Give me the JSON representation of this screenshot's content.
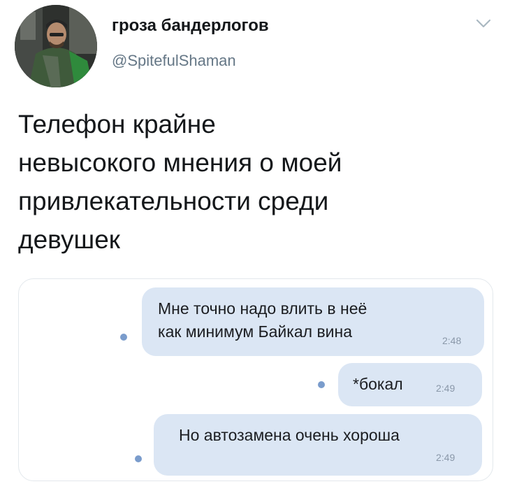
{
  "tweet": {
    "author_name": "гроза бандерлогов",
    "author_handle": "@SpitefulShaman",
    "text_lines": [
      "Телефон крайне",
      "невысокого мнения о моей",
      "привлекательности среди",
      "девушек"
    ]
  },
  "chat": {
    "messages": [
      {
        "lines": [
          "Мне точно надо влить в неё",
          "как минимум Байкал вина"
        ],
        "time": "2:48"
      },
      {
        "lines": [
          "*бокал"
        ],
        "time": "2:49"
      },
      {
        "lines": [
          "Но автозамена очень хороша"
        ],
        "time": "2:49"
      }
    ]
  },
  "icons": {
    "menu": "chevron-down-icon",
    "unread_marker": "unread-dot-icon"
  },
  "colors": {
    "bubble": "#dbe6f4",
    "dot": "#7a9ccc",
    "handle": "#657786"
  }
}
